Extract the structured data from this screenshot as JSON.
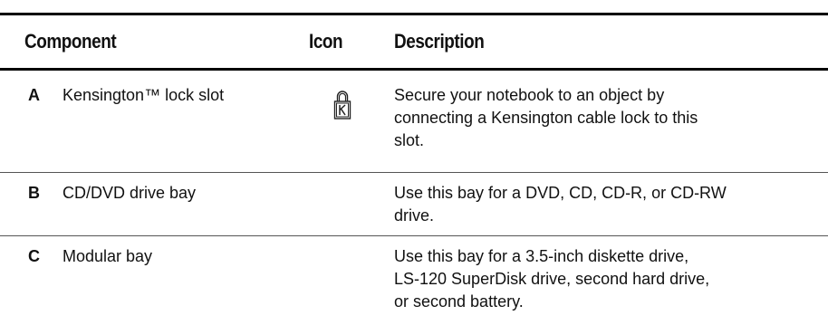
{
  "table": {
    "headers": {
      "component": "Component",
      "icon": "Icon",
      "description": "Description"
    },
    "rows": [
      {
        "letter": "A",
        "component": "Kensington™ lock slot",
        "icon": "kensington-lock-icon",
        "description_lines": [
          "Secure your notebook to an object by",
          "connecting a Kensington cable lock to this",
          "slot."
        ]
      },
      {
        "letter": "B",
        "component": "CD/DVD drive bay",
        "icon": "",
        "description_lines": [
          "Use this bay for a DVD, CD, CD-R, or CD-RW",
          "drive."
        ]
      },
      {
        "letter": "C",
        "component": "Modular bay",
        "icon": "",
        "description_lines": [
          "Use this bay for a 3.5-inch diskette drive,",
          "LS-120 SuperDisk drive, second hard drive,",
          "or second battery."
        ]
      }
    ]
  }
}
